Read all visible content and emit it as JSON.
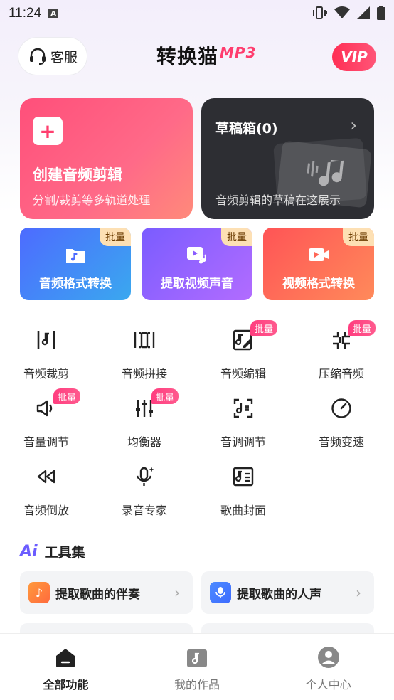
{
  "status_bar": {
    "time": "11:24",
    "a_icon": "A"
  },
  "header": {
    "service_label": "客服",
    "logo_text": "转换猫",
    "logo_suffix": "MP3",
    "vip_label": "VIP"
  },
  "cards": {
    "create": {
      "title": "创建音频剪辑",
      "subtitle": "分割/裁剪等多轨道处理",
      "icon": "plus-icon"
    },
    "draft": {
      "title": "草稿箱(0)",
      "subtitle": "音频剪辑的草稿在这展示",
      "chevron": "›"
    }
  },
  "features": [
    {
      "label": "音频格式转换",
      "badge": "批量",
      "icon": "audio-folder-icon"
    },
    {
      "label": "提取视频声音",
      "badge": "批量",
      "icon": "video-music-icon"
    },
    {
      "label": "视频格式转换",
      "badge": "批量",
      "icon": "video-camera-icon"
    }
  ],
  "tools": [
    {
      "label": "音频裁剪",
      "badge": ""
    },
    {
      "label": "音频拼接",
      "badge": ""
    },
    {
      "label": "音频编辑",
      "badge": "批量"
    },
    {
      "label": "压缩音频",
      "badge": "批量"
    },
    {
      "label": "音量调节",
      "badge": "批量"
    },
    {
      "label": "均衡器",
      "badge": "批量"
    },
    {
      "label": "音调调节",
      "badge": ""
    },
    {
      "label": "音频变速",
      "badge": ""
    },
    {
      "label": "音频倒放",
      "badge": ""
    },
    {
      "label": "录音专家",
      "badge": ""
    },
    {
      "label": "歌曲封面",
      "badge": ""
    }
  ],
  "toolkit": {
    "title": "工具集",
    "ai_label": "Ai",
    "items": [
      {
        "label": "提取歌曲的伴奏",
        "icon_color": "#ff7a3d"
      },
      {
        "label": "提取歌曲的人声",
        "icon_color": "#3d7bff"
      }
    ]
  },
  "tabbar": [
    {
      "label": "全部功能",
      "active": true
    },
    {
      "label": "我的作品",
      "active": false
    },
    {
      "label": "个人中心",
      "active": false
    }
  ],
  "colors": {
    "accent_pink": "#ff4f7a",
    "dark_card": "#2d2e33",
    "badge_pink": "#ff3d7f"
  }
}
